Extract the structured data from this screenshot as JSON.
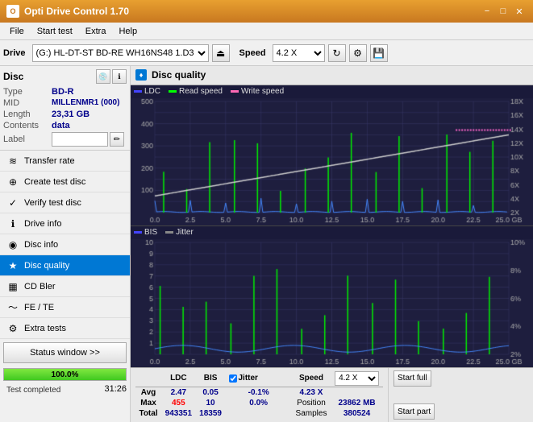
{
  "titlebar": {
    "title": "Opti Drive Control 1.70",
    "icon": "O",
    "min": "−",
    "max": "□",
    "close": "✕"
  },
  "menubar": {
    "items": [
      "File",
      "Start test",
      "Extra",
      "Help"
    ]
  },
  "toolbar": {
    "drive_label": "Drive",
    "drive_value": "(G:)  HL-DT-ST BD-RE  WH16NS48 1.D3",
    "speed_label": "Speed",
    "speed_value": "4.2 X"
  },
  "left_panel": {
    "disc_title": "Disc",
    "disc_fields": [
      {
        "key": "Type",
        "val": "BD-R"
      },
      {
        "key": "MID",
        "val": "MILLENMR1 (000)"
      },
      {
        "key": "Length",
        "val": "23,31 GB"
      },
      {
        "key": "Contents",
        "val": "data"
      }
    ],
    "label_placeholder": "",
    "nav_items": [
      {
        "label": "Transfer rate",
        "icon": "≋",
        "active": false
      },
      {
        "label": "Create test disc",
        "icon": "⊕",
        "active": false
      },
      {
        "label": "Verify test disc",
        "icon": "✓",
        "active": false
      },
      {
        "label": "Drive info",
        "icon": "ℹ",
        "active": false
      },
      {
        "label": "Disc info",
        "icon": "◉",
        "active": false
      },
      {
        "label": "Disc quality",
        "icon": "★",
        "active": true
      },
      {
        "label": "CD Bler",
        "icon": "▦",
        "active": false
      },
      {
        "label": "FE / TE",
        "icon": "〜",
        "active": false
      },
      {
        "label": "Extra tests",
        "icon": "⚙",
        "active": false
      }
    ],
    "status_btn": "Status window >>",
    "progress": 100,
    "progress_text": "100.0%",
    "status_text": "Test completed",
    "time_text": "31:26"
  },
  "chart_header": {
    "title": "Disc quality",
    "icon": "♦"
  },
  "legend_top": {
    "items": [
      {
        "label": "LDC",
        "color": "#0000ff"
      },
      {
        "label": "Read speed",
        "color": "#00ff00"
      },
      {
        "label": "Write speed",
        "color": "#ff69b4"
      }
    ]
  },
  "legend_bottom": {
    "items": [
      {
        "label": "BIS",
        "color": "#0000ff"
      },
      {
        "label": "Jitter",
        "color": "#888888"
      }
    ]
  },
  "stats": {
    "headers": [
      "LDC",
      "BIS",
      "",
      "Jitter",
      "Speed",
      ""
    ],
    "avg": {
      "ldc": "2.47",
      "bis": "0.05",
      "jitter": "-0.1%",
      "speed": "4.23 X",
      "speed_select": "4.2 X"
    },
    "max": {
      "ldc": "455",
      "bis": "10",
      "jitter": "0.0%",
      "position": "23862 MB"
    },
    "total": {
      "ldc": "943351",
      "bis": "18359",
      "samples": "380524"
    },
    "avg_label": "Avg",
    "max_label": "Max",
    "total_label": "Total",
    "position_label": "Position",
    "samples_label": "Samples",
    "start_full_label": "Start full",
    "start_part_label": "Start part",
    "jitter_checked": true,
    "jitter_label": "Jitter"
  },
  "chart": {
    "top": {
      "y_max": 500,
      "y_labels": [
        "500",
        "400",
        "300",
        "200",
        "100"
      ],
      "right_labels": [
        "18X",
        "16X",
        "14X",
        "12X",
        "10X",
        "8X",
        "6X",
        "4X",
        "2X"
      ],
      "x_labels": [
        "0.0",
        "2.5",
        "5.0",
        "7.5",
        "10.0",
        "12.5",
        "15.0",
        "17.5",
        "20.0",
        "22.5",
        "25.0 GB"
      ]
    },
    "bottom": {
      "y_max": 10,
      "y_labels": [
        "10",
        "9",
        "8",
        "7",
        "6",
        "5",
        "4",
        "3",
        "2",
        "1"
      ],
      "right_labels": [
        "10%",
        "8%",
        "6%",
        "4%",
        "2%"
      ],
      "x_labels": [
        "0.0",
        "2.5",
        "5.0",
        "7.5",
        "10.0",
        "12.5",
        "15.0",
        "17.5",
        "20.0",
        "22.5",
        "25.0 GB"
      ]
    }
  }
}
